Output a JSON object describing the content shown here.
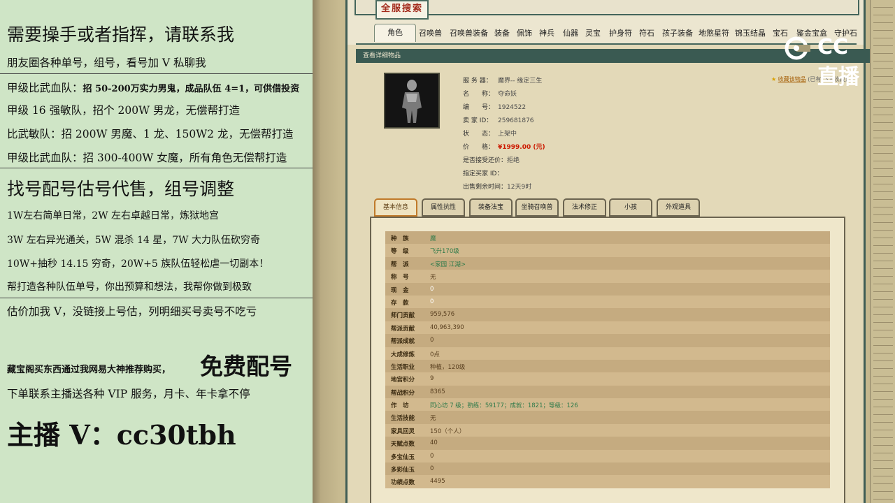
{
  "left_panel": {
    "lines": [
      "需要操手或者指挥，请联系我",
      "朋友圈各种单号，组号，看号加 V 私聊我",
      "甲级比武血队：",
      "招 50-200万实力男鬼，成品队伍 4=1，可供借投资",
      "甲级 16 强敏队，招个 200W 男龙，无偿帮打造",
      "比武敏队：招 200W 男魔、1 龙、150W2 龙，无偿帮打造",
      "甲级比武血队：招 300-400W 女魔，所有角色无偿帮打造",
      "找号配号估号代售，组号调整",
      "1W左右简单日常，2W 左右卓越日常，炼狱地宫",
      "3W 左右异光通关，5W 混杀 14 星，7W 大力队伍砍穷奇",
      "10W+抽秒 14.15 穷奇，20W+5 族队伍轻松虐一切副本！",
      "帮打造各种队伍单号，你出预算和想法，我帮你做到极致",
      "估价加我 V，没链接上号估，列明细买号卖号不吃亏",
      "藏宝阁买东西通过我网易大神推荐购买，",
      "免费配号",
      "下单联系主播送各种 VIP 服务，月卡、年卡拿不停",
      "主播 V：cc30tbh"
    ]
  },
  "header": {
    "search_title": "全服搜索",
    "tabs": [
      "角色",
      "召唤兽",
      "召唤兽装备",
      "装备",
      "佩饰",
      "神兵",
      "仙器",
      "灵宝",
      "护身符",
      "符石",
      "孩子装备",
      "地煞星符",
      "锦玉结晶",
      "宝石",
      "鉴金宝盒",
      "守护石"
    ]
  },
  "sub_header": "查看详细物品",
  "item_info": [
    {
      "label": "服 务 器：",
      "value": "魔界-- 缘定三生"
    },
    {
      "label": "名　　称：",
      "value": "夺命妖"
    },
    {
      "label": "编　　号：",
      "value": "1924522"
    },
    {
      "label": "卖 家 ID：",
      "value": "259681876"
    },
    {
      "label": "状　　态：",
      "value": "上架中"
    },
    {
      "label": "价　　格：",
      "value": "¥1999.00 (元)"
    },
    {
      "label": "是否接受还价：",
      "value": "拒绝"
    },
    {
      "label": "指定买家 ID：",
      "value": ""
    },
    {
      "label": "出售剩余时间：",
      "value": "12天9时"
    }
  ],
  "favorite": {
    "link": "收藏该物品",
    "count": "(已有13人收藏)"
  },
  "detail_tabs": [
    "基本信息",
    "属性抗性",
    "装备法宝",
    "坐骑召唤兽",
    "法术修正",
    "小孩",
    "外观道具"
  ],
  "attributes": [
    {
      "k": "种　族",
      "v": "魔",
      "style": "green"
    },
    {
      "k": "等　级",
      "v": "飞升170级",
      "style": "green"
    },
    {
      "k": "帮　派",
      "v": "<家园 江湖>",
      "style": "green"
    },
    {
      "k": "称　号",
      "v": "无",
      "style": ""
    },
    {
      "k": "现　金",
      "v": "0",
      "style": "white"
    },
    {
      "k": "存　款",
      "v": "0",
      "style": "white"
    },
    {
      "k": "师门贡献",
      "v": "959,576",
      "style": ""
    },
    {
      "k": "帮派贡献",
      "v": "40,963,390",
      "style": ""
    },
    {
      "k": "帮派成就",
      "v": "0",
      "style": ""
    },
    {
      "k": "大成修炼",
      "v": "0点",
      "style": ""
    },
    {
      "k": "生活职业",
      "v": "种植，120级",
      "style": ""
    },
    {
      "k": "地宫积分",
      "v": "9",
      "style": ""
    },
    {
      "k": "帮战积分",
      "v": "8365",
      "style": ""
    },
    {
      "k": "作　坊",
      "v": "同心坊 7 级；熟练：59177；成就：1821；等级：126",
      "style": "green"
    },
    {
      "k": "生活技能",
      "v": "无",
      "style": ""
    },
    {
      "k": "家具回灵",
      "v": "150（个人）",
      "style": ""
    },
    {
      "k": "天赋点数",
      "v": "40",
      "style": ""
    },
    {
      "k": "多宝仙玉",
      "v": "0",
      "style": ""
    },
    {
      "k": "多彩仙玉",
      "v": "0",
      "style": ""
    },
    {
      "k": "功绩点数",
      "v": "4495",
      "style": ""
    }
  ],
  "watermark": "CC直播"
}
